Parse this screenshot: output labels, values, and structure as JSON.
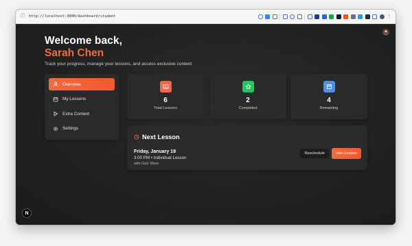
{
  "browser": {
    "url": "http://localhost:3000/dashboard/student"
  },
  "header": {
    "greeting": "Welcome back,",
    "name": "Sarah Chen",
    "subtitle": "Track your progress, manage your lessons, and access exclusive content"
  },
  "sidebar": {
    "items": [
      {
        "label": "Overview",
        "icon": "user-icon",
        "active": true
      },
      {
        "label": "My Lessons",
        "icon": "calendar-icon",
        "active": false
      },
      {
        "label": "Extra Content",
        "icon": "play-icon",
        "active": false
      },
      {
        "label": "Settings",
        "icon": "gear-icon",
        "active": false
      }
    ]
  },
  "stats": [
    {
      "value": "6",
      "label": "Total Lessons",
      "icon": "book-icon",
      "color": "#f2664a"
    },
    {
      "value": "2",
      "label": "Completed",
      "icon": "star-icon",
      "color": "#22c55e"
    },
    {
      "value": "4",
      "label": "Remaining",
      "icon": "calendar-icon",
      "color": "#4f8ff0"
    }
  ],
  "next_lesson": {
    "title": "Next Lesson",
    "date": "Friday, January 19",
    "time": "3:00 PM • Individual Lesson",
    "with": "with Güd Vibes",
    "reschedule_label": "Reschedule",
    "join_label": "Join Lesson"
  },
  "colors": {
    "accent": "#f06b43",
    "background": "#232323",
    "card": "#2a2a2a"
  },
  "dev_indicator": "N"
}
